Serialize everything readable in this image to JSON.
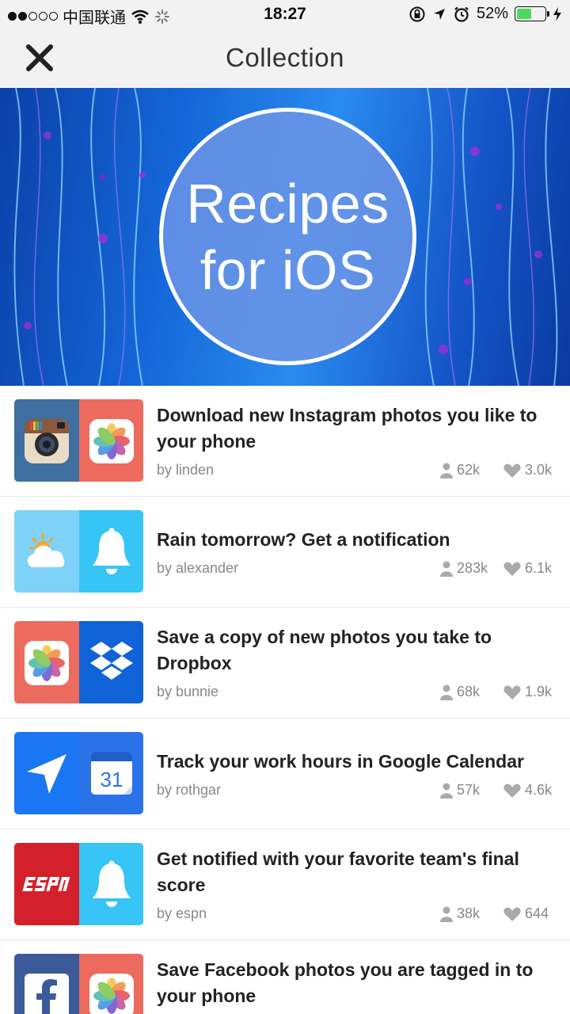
{
  "status_bar": {
    "carrier": "中国联通",
    "time": "18:27",
    "battery_percent": "52%",
    "battery_level": 0.52
  },
  "nav": {
    "title": "Collection"
  },
  "hero": {
    "line1": "Recipes",
    "line2": "for iOS"
  },
  "recipes": [
    {
      "title": "Download new Instagram photos you like to your phone",
      "author": "by linden",
      "users": "62k",
      "likes": "3.0k",
      "left_icon": "instagram-icon",
      "right_icon": "photos-icon",
      "left_color": "#3f6fa0",
      "right_color": "#ec6b5e"
    },
    {
      "title": "Rain tomorrow? Get a notification",
      "author": "by alexander",
      "users": "283k",
      "likes": "6.1k",
      "left_icon": "weather-icon",
      "right_icon": "bell-icon",
      "left_color": "#7fd2f7",
      "right_color": "#36c5f4"
    },
    {
      "title": "Save a copy of new photos you take to Dropbox",
      "author": "by bunnie",
      "users": "68k",
      "likes": "1.9k",
      "left_icon": "photos-icon",
      "right_icon": "dropbox-icon",
      "left_color": "#ec6b5e",
      "right_color": "#1063d6"
    },
    {
      "title": "Track your work hours in Google Calendar",
      "author": "by rothgar",
      "users": "57k",
      "likes": "4.6k",
      "left_icon": "location-arrow-icon",
      "right_icon": "google-calendar-icon",
      "left_color": "#1a76f2",
      "right_color": "#2a72e8"
    },
    {
      "title": "Get notified with your favorite team's final score",
      "author": "by espn",
      "users": "38k",
      "likes": "644",
      "left_icon": "espn-icon",
      "right_icon": "bell-icon",
      "left_color": "#d4202a",
      "right_color": "#36c5f4"
    },
    {
      "title": "Save Facebook photos you are tagged in to your phone",
      "author": "",
      "users": "",
      "likes": "",
      "left_icon": "facebook-icon",
      "right_icon": "photos-icon",
      "left_color": "#3b5a9a",
      "right_color": "#ec6b5e"
    }
  ]
}
